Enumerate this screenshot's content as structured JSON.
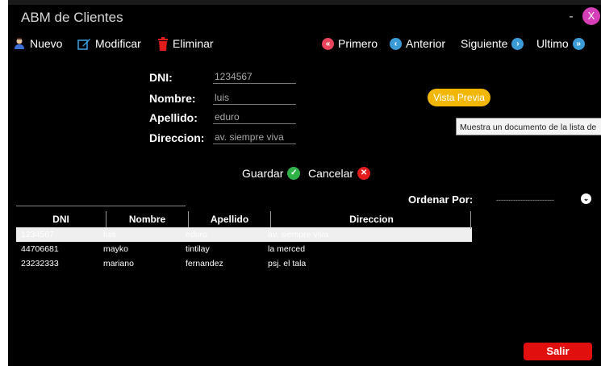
{
  "window": {
    "title": "ABM de Clientes",
    "minimize_label": "-",
    "close_label": "X"
  },
  "toolbar": {
    "nuevo": "Nuevo",
    "modificar": "Modificar",
    "eliminar": "Eliminar",
    "primero": "Primero",
    "anterior": "Anterior",
    "siguiente": "Siguiente",
    "ultimo": "Ultimo"
  },
  "form": {
    "dni_label": "DNI:",
    "dni_value": "1234567",
    "nombre_label": "Nombre:",
    "nombre_value": "luis",
    "apellido_label": "Apellido:",
    "apellido_value": "eduro",
    "direccion_label": "Direccion:",
    "direccion_value": "av. siempre viva"
  },
  "vista_previa": {
    "label": "Vista Previa",
    "tooltip": "Muestra un documento de la lista de"
  },
  "actions": {
    "guardar": "Guardar",
    "cancelar": "Cancelar"
  },
  "sort": {
    "label": "Ordenar Por:",
    "value": "------------------------"
  },
  "table": {
    "columns": [
      "DNI",
      "Nombre",
      "Apellido",
      "Direccion"
    ],
    "rows": [
      {
        "dni": "1234567",
        "nombre": "luis",
        "apellido": "eduro",
        "direccion": "av. siempre viva",
        "selected": true
      },
      {
        "dni": "44706681",
        "nombre": "mayko",
        "apellido": "tintilay",
        "direccion": "la merced"
      },
      {
        "dni": "23232333",
        "nombre": "mariano",
        "apellido": "fernandez",
        "direccion": "psj. el tala"
      }
    ]
  },
  "footer": {
    "salir": "Salir"
  },
  "colors": {
    "background": "#000000",
    "vista_previa": "#f2b705",
    "salir": "#e20f0f",
    "close": "#d63fb8",
    "nav_pink": "#e8455a",
    "nav_blue": "#3b9bd6"
  }
}
